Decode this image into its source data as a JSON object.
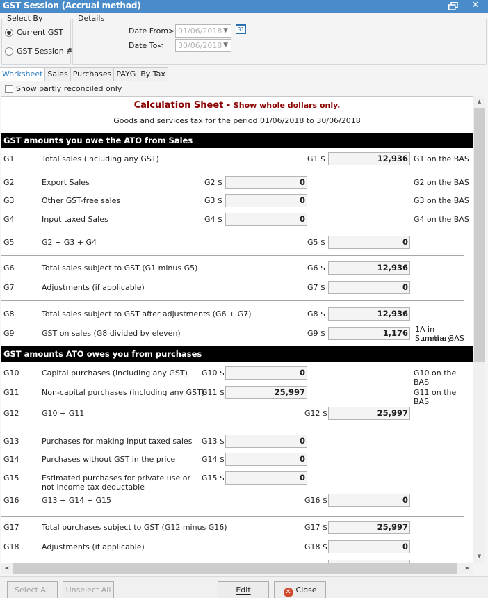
{
  "window": {
    "title": "GST Session (Accrual method)",
    "restore_icon": "restore-icon",
    "close_icon": "close-icon"
  },
  "select_by": {
    "legend": "Select By",
    "options": [
      {
        "label": "Current GST",
        "selected": true
      },
      {
        "label": "GST Session #",
        "selected": false
      }
    ]
  },
  "details": {
    "legend": "Details",
    "date_from_label": "Date From>",
    "date_from_value": "01/06/2018",
    "date_to_label": "Date To<",
    "date_to_value": "30/06/2018",
    "calendar_icon_text": "31"
  },
  "tabs": [
    {
      "label": "Worksheet",
      "active": true
    },
    {
      "label": "Sales",
      "active": false
    },
    {
      "label": "Purchases",
      "active": false
    },
    {
      "label": "PAYG",
      "active": false
    },
    {
      "label": "By Tax",
      "active": false
    }
  ],
  "show_partly_label": "Show partly reconciled only",
  "sheet": {
    "title": "Calculation Sheet",
    "title_sep": " - ",
    "title_note": "Show whole dollars only.",
    "subtitle": "Goods and services tax for the period 01/06/2018 to 30/06/2018",
    "sales_header": "GST amounts you owe the ATO from Sales",
    "purchases_header": "GST amounts ATO owes you from purchases",
    "rows": {
      "g1": {
        "code": "G1",
        "desc": "Total sales (including any GST)",
        "label": "G1 $",
        "value": "12,936",
        "bas": "G1 on the BAS"
      },
      "g2": {
        "code": "G2",
        "desc": "Export Sales",
        "label": "G2 $",
        "value": "0",
        "bas": "G2 on the BAS"
      },
      "g3": {
        "code": "G3",
        "desc": "Other GST-free sales",
        "label": "G3 $",
        "value": "0",
        "bas": "G3 on the BAS"
      },
      "g4": {
        "code": "G4",
        "desc": "Input taxed Sales",
        "label": "G4 $",
        "value": "0",
        "bas": "G4 on the BAS"
      },
      "g5": {
        "code": "G5",
        "desc": "G2 + G3 + G4",
        "label": "G5 $",
        "value": "0"
      },
      "g6": {
        "code": "G6",
        "desc": "Total sales subject to GST (G1 minus G5)",
        "label": "G6 $",
        "value": "12,936"
      },
      "g7": {
        "code": "G7",
        "desc": "Adjustments (if applicable)",
        "label": "G7 $",
        "value": "0"
      },
      "g8": {
        "code": "G8",
        "desc": "Total sales subject to GST after adjustments (G6 + G7)",
        "label": "G8 $",
        "value": "12,936"
      },
      "g9": {
        "code": "G9",
        "desc": "GST on sales (G8 divided by eleven)",
        "label": "G9 $",
        "value": "1,176",
        "bas_line1": "1A in Summary",
        "bas_line2": "on the BAS"
      },
      "g10": {
        "code": "G10",
        "desc": "Capital purchases (including any GST)",
        "label": "G10 $",
        "value": "0",
        "bas": "G10 on the BAS"
      },
      "g11": {
        "code": "G11",
        "desc": "Non-capital purchases (including any GST)",
        "label": "G11 $",
        "value": "25,997",
        "bas": "G11 on the BAS"
      },
      "g12": {
        "code": "G12",
        "desc": "G10 + G11",
        "label": "G12 $",
        "value": "25,997"
      },
      "g13": {
        "code": "G13",
        "desc": "Purchases for making input taxed sales",
        "label": "G13 $",
        "value": "0"
      },
      "g14": {
        "code": "G14",
        "desc": "Purchases without GST in the price",
        "label": "G14 $",
        "value": "0"
      },
      "g15": {
        "code": "G15",
        "desc_line1": "Estimated purchases for private use or",
        "desc_line2": "not income tax deductable",
        "label": "G15 $",
        "value": "0"
      },
      "g16": {
        "code": "G16",
        "desc": "G13 + G14 + G15",
        "label": "G16 $",
        "value": "0"
      },
      "g17": {
        "code": "G17",
        "desc": "Total purchases subject to GST (G12 minus G16)",
        "label": "G17 $",
        "value": "25,997"
      },
      "g18": {
        "code": "G18",
        "desc": "Adjustments (if applicable)",
        "label": "G18 $",
        "value": "0"
      }
    }
  },
  "buttons": {
    "select_all": "Select All",
    "unselect_all": "Unselect All",
    "edit": "Edit",
    "close": "Close"
  }
}
